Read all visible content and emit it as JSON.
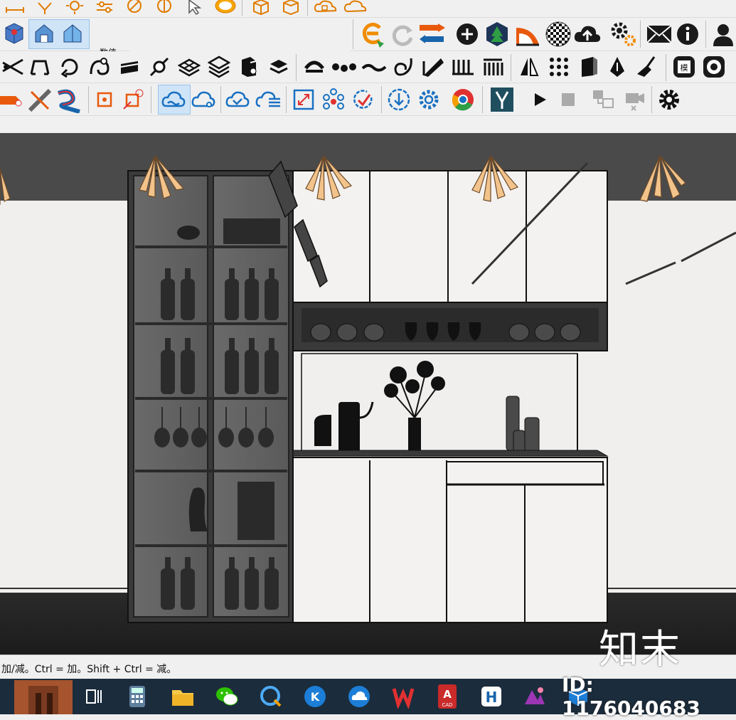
{
  "vcb": {
    "label": "数值"
  },
  "status": {
    "text": "加/减。Ctrl = 加。Shift + Ctrl = 减。"
  },
  "watermark": {
    "brand": "知末",
    "id": "ID: 1176040683"
  },
  "taskbar": {
    "cad_label": "CAD"
  },
  "icons": {
    "row0": [
      "dimension-icon",
      "hatch-icon",
      "sun-icon",
      "sliders-icon",
      "compass-icon",
      "compass-alt-icon",
      "select-arrow-icon",
      "bubble-icon",
      "box-icon",
      "box-open-icon",
      "cloud-cube-icon",
      "cloud-icon"
    ],
    "row1": [
      "cube-blue-icon",
      "house-view-icon",
      "house-view-alt-icon",
      "enscape-icon",
      "refresh-icon",
      "transfer-icon",
      "plus-circle-icon",
      "tree-badge-icon",
      "protractor-icon",
      "checker-sphere-icon",
      "cloud-upload-icon",
      "gears-icon",
      "mail-icon",
      "info-icon",
      "user-icon"
    ],
    "row2": [
      "scissors-icon",
      "arch-icon",
      "loop-icon",
      "spiral-icon",
      "bar-icon",
      "node-line-icon",
      "grid-stack-icon",
      "grid-stack-alt-icon",
      "pillar-icon",
      "stamp-icon",
      "arc-icon",
      "dots-line-icon",
      "wave-icon",
      "curl-icon",
      "ruler-icon",
      "fence-icon",
      "columns-icon",
      "mirror-icon",
      "dot-grid-icon",
      "panel-icon",
      "pen-nib-icon",
      "broom-icon",
      "model-badge-icon",
      "circle-tag-icon"
    ],
    "row3": [
      "pencil-x-icon",
      "cross-scissors-icon",
      "route-icon",
      "square-dot-icon",
      "square-x-icon",
      "cloud-link-icon",
      "cloud-share-icon",
      "cloud-check-icon",
      "cloud-list-icon",
      "expand-box-icon",
      "molecule-icon",
      "check-rotate-icon",
      "download-circle-icon",
      "gear-blue-icon",
      "chrome-icon",
      "y-logo-icon",
      "play-icon",
      "stop-icon",
      "swap-frames-icon",
      "camera-x-icon",
      "settings-gear-icon"
    ],
    "taskbar": [
      "start-thumbnail-icon",
      "task-view-icon",
      "calculator-icon",
      "file-explorer-icon",
      "wechat-icon",
      "chat-link-icon",
      "k-app-icon",
      "cloud-app-icon",
      "wps-icon",
      "cad-icon",
      "h-app-icon",
      "art-app-icon",
      "sketchup-icon"
    ]
  }
}
